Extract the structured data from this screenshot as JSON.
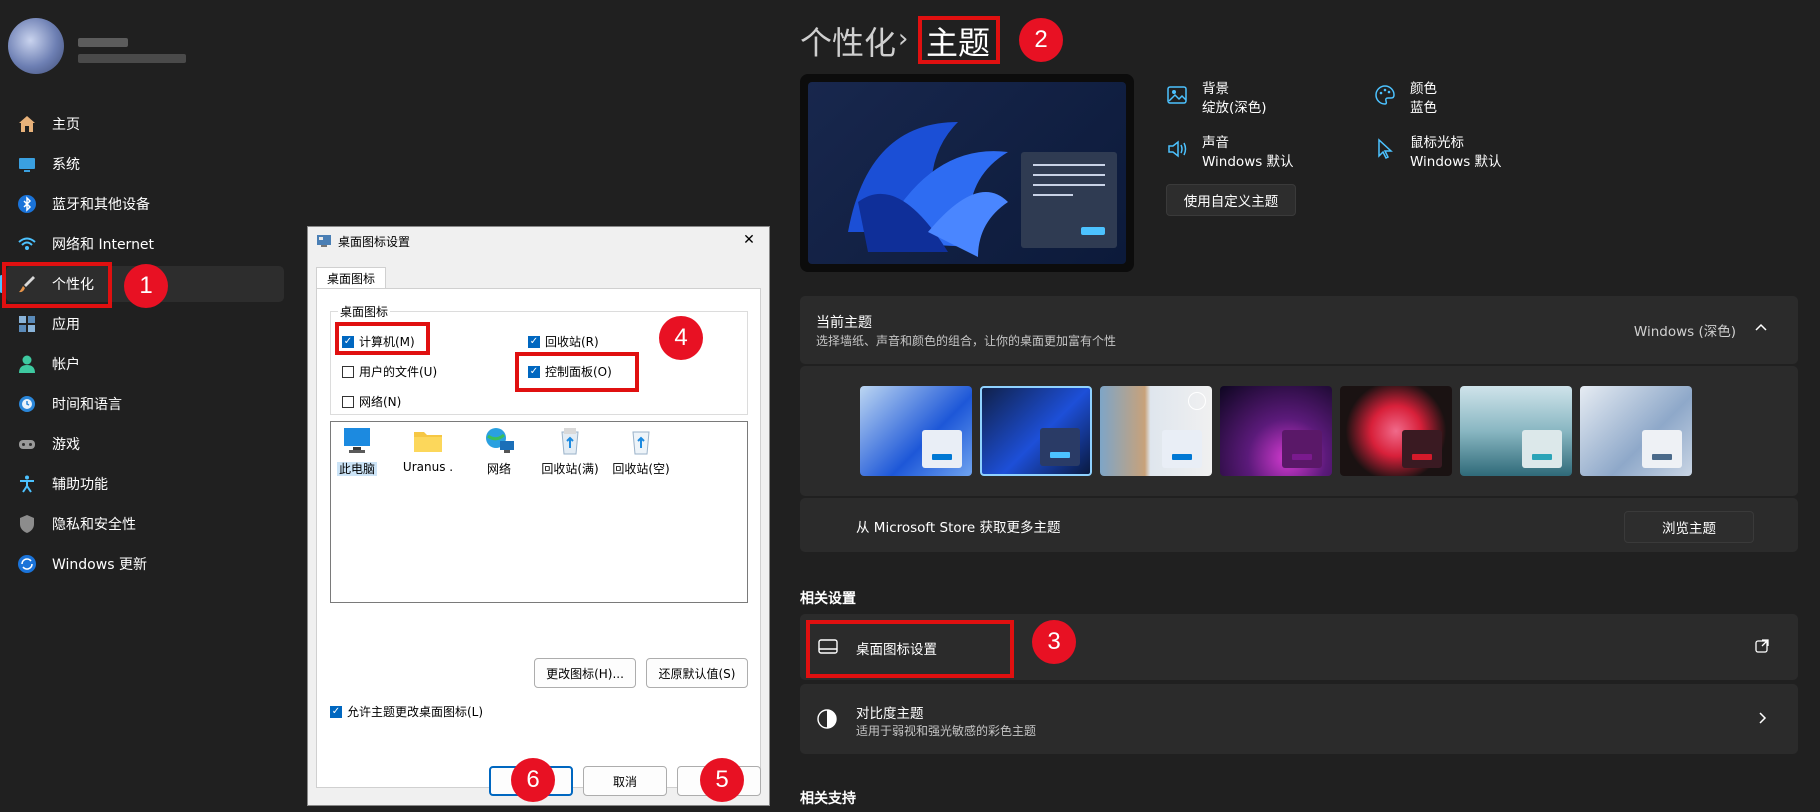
{
  "sidebar": {
    "items": [
      {
        "label": "主页",
        "icon": "home-icon"
      },
      {
        "label": "系统",
        "icon": "display-icon"
      },
      {
        "label": "蓝牙和其他设备",
        "icon": "bluetooth-icon"
      },
      {
        "label": "网络和 Internet",
        "icon": "wifi-icon"
      },
      {
        "label": "个性化",
        "icon": "brush-icon"
      },
      {
        "label": "应用",
        "icon": "apps-icon"
      },
      {
        "label": "帐户",
        "icon": "person-icon"
      },
      {
        "label": "时间和语言",
        "icon": "clock-globe-icon"
      },
      {
        "label": "游戏",
        "icon": "gamepad-icon"
      },
      {
        "label": "辅助功能",
        "icon": "accessibility-icon"
      },
      {
        "label": "隐私和安全性",
        "icon": "shield-icon"
      },
      {
        "label": "Windows 更新",
        "icon": "update-icon"
      }
    ],
    "active_index": 4
  },
  "header": {
    "parent": "个性化",
    "separator": "›",
    "current": "主题"
  },
  "props": {
    "background": {
      "label": "背景",
      "value": "绽放(深色)"
    },
    "color": {
      "label": "颜色",
      "value": "蓝色"
    },
    "sound": {
      "label": "声音",
      "value": "Windows 默认"
    },
    "cursor": {
      "label": "鼠标光标",
      "value": "Windows 默认"
    },
    "custom_button": "使用自定义主题"
  },
  "current_theme": {
    "title": "当前主题",
    "desc": "选择墙纸、声音和颜色的组合，让你的桌面更加富有个性",
    "value": "Windows (深色)"
  },
  "store": {
    "text": "从 Microsoft Store 获取更多主题",
    "button": "浏览主题"
  },
  "related": {
    "heading": "相关设置",
    "desktop_icons": "桌面图标设置",
    "contrast_title": "对比度主题",
    "contrast_desc": "适用于弱视和强光敏感的彩色主题"
  },
  "support_heading": "相关支持",
  "dialog": {
    "title": "桌面图标设置",
    "tab": "桌面图标",
    "group": "桌面图标",
    "cb_computer": "计算机(M)",
    "cb_recycle": "回收站(R)",
    "cb_userfiles": "用户的文件(U)",
    "cb_control": "控制面板(O)",
    "cb_network": "网络(N)",
    "icons": [
      "此电脑",
      "Uranus .",
      "网络",
      "回收站(满)",
      "回收站(空)"
    ],
    "change_icon": "更改图标(H)...",
    "restore_default": "还原默认值(S)",
    "allow_themes": "允许主题更改桌面图标(L)",
    "cancel": "取消",
    "close_glyph": "✕"
  },
  "annotations": [
    "1",
    "2",
    "3",
    "4",
    "5",
    "6"
  ],
  "colors": {
    "accent": "#4cc2ff",
    "annotation_red": "#e01010",
    "badge_red": "#e81123"
  }
}
